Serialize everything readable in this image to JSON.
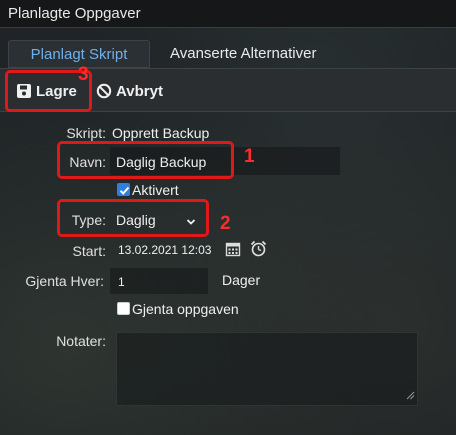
{
  "window": {
    "title": "Planlagte Oppgaver"
  },
  "tabs": [
    {
      "label": "Planlagt Skript",
      "active": true
    },
    {
      "label": "Avanserte Alternativer",
      "active": false
    }
  ],
  "toolbar": {
    "save_label": "Lagre",
    "cancel_label": "Avbryt"
  },
  "form": {
    "script_label": "Skript:",
    "script_value": "Opprett Backup",
    "name_label": "Navn:",
    "name_value": "Daglig Backup",
    "enabled_label": "Aktivert",
    "enabled_checked": true,
    "type_label": "Type:",
    "type_value": "Daglig",
    "start_label": "Start:",
    "start_value": "13.02.2021 12:03",
    "repeat_label": "Gjenta Hver:",
    "repeat_value": "1",
    "repeat_unit": "Dager",
    "repeat_task_label": "Gjenta oppgaven",
    "repeat_task_checked": false,
    "notes_label": "Notater:",
    "notes_value": ""
  },
  "annotations": [
    "1",
    "2",
    "3"
  ],
  "colors": {
    "accent": "#6fb1e8",
    "highlight": "#e01818",
    "checkbox": "#2f7fe0"
  }
}
